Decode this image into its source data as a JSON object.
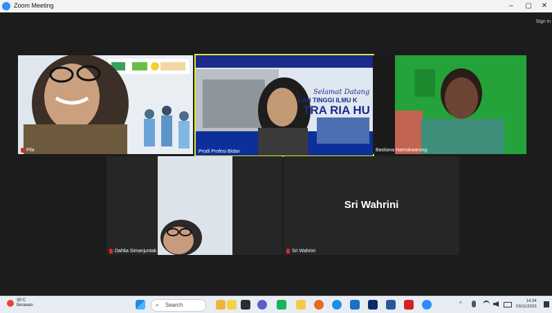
{
  "window": {
    "title": "Zoom Meeting",
    "controls": [
      "–",
      "▢",
      "✕"
    ]
  },
  "meeting": {
    "signin_text": "Sign in"
  },
  "participants": [
    {
      "name": "Pila",
      "mic_muted": true
    },
    {
      "name": "Prodi Profesi Bidan",
      "mic_muted": false,
      "active_speaker": true,
      "banner_text_1": "Selamat Datang",
      "banner_text_2": "LAH TINGGI ILMU K",
      "banner_text_3": "TRA RIA HU"
    },
    {
      "name": "Bastiana Hamokwarong",
      "mic_muted": false
    },
    {
      "name": "Dahlia Simanjuntak",
      "mic_muted": true
    },
    {
      "name": "Sri Wahrini",
      "mic_muted": true,
      "display_text": "Sri Wahrini"
    }
  ],
  "taskbar": {
    "weather_temp": "35°C",
    "weather_desc": "Berawan",
    "search_label": "Search",
    "time": "14:34",
    "date": "03/11/2023"
  },
  "colors": {
    "active_speaker_border": "#e5e835",
    "mute_red": "#e02828",
    "zoom_blue": "#2d8cff"
  }
}
